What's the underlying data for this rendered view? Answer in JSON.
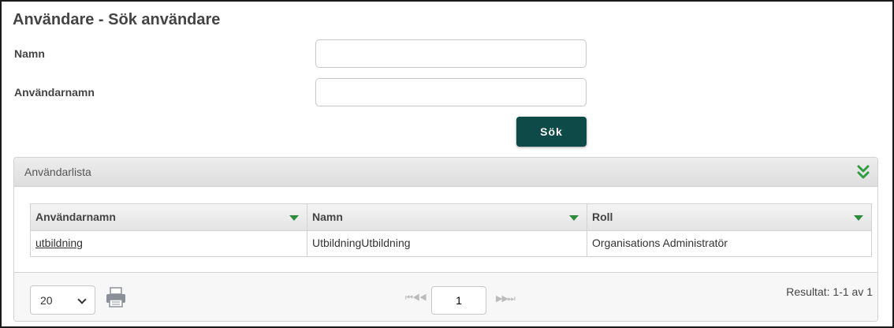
{
  "page": {
    "title": "Användare - Sök användare"
  },
  "search_form": {
    "name_label": "Namn",
    "name_value": "",
    "username_label": "Användarnamn",
    "username_value": "",
    "search_button": "Sök"
  },
  "user_list": {
    "title": "Användarlista",
    "columns": [
      "Användarnamn",
      "Namn",
      "Roll"
    ],
    "rows": [
      {
        "username": "utbildning",
        "name": "UtbildningUtbildning",
        "role": "Organisations Administratör"
      }
    ]
  },
  "pager": {
    "page_size": "20",
    "current_page": "1",
    "first_label": "⏮◀◀",
    "last_label": "▶▶⏭",
    "result_text": "Resultat: 1-1 av 1"
  },
  "colors": {
    "accent": "#0e4a47",
    "sort_arrow": "#2e8b3a"
  },
  "icons": {
    "collapse": "double-chevron-down-icon",
    "print": "printer-icon",
    "sort": "sort-arrow-down-icon"
  }
}
